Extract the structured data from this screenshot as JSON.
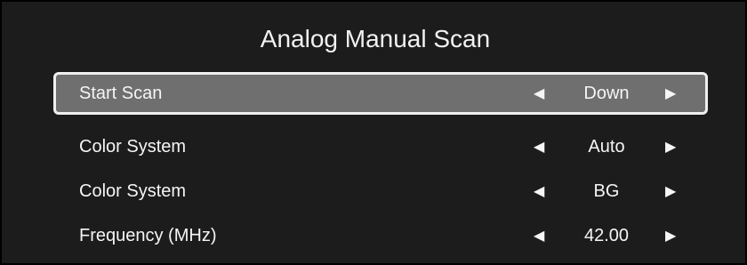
{
  "menu": {
    "title": "Analog Manual Scan",
    "rows": [
      {
        "label": "Start Scan",
        "value": "Down",
        "left_arrow": "◀",
        "right_arrow": "▶"
      },
      {
        "label": "Color System",
        "value": "Auto",
        "left_arrow": "◀",
        "right_arrow": "▶"
      },
      {
        "label": "Color System",
        "value": "BG",
        "left_arrow": "◀",
        "right_arrow": "▶"
      },
      {
        "label": "Frequency (MHz)",
        "value": "42.00",
        "left_arrow": "◀",
        "right_arrow": "▶"
      }
    ]
  },
  "colors": {
    "background": "#1c1c1c",
    "selected_row": "#6f6f6f",
    "selected_border": "#f0f0f0",
    "text": "#f5f5f5"
  },
  "icons": {
    "left_arrow": "triangle-left-icon",
    "right_arrow": "triangle-right-icon"
  },
  "selected_index": 0
}
